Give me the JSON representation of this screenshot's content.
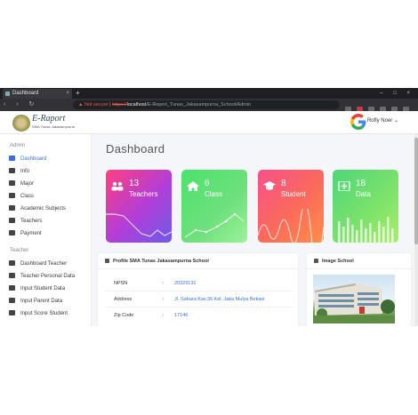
{
  "browser": {
    "tab_title": "Dashboard",
    "tab_close": "×",
    "new_tab": "+",
    "window_controls": "– □ ×",
    "nav_buttons": "‹ › ↻",
    "url_warning": "▲ Not secure",
    "url_scheme": "https://",
    "url_host": "localhost",
    "url_path": "/E-Report_Tunas_Jakasampurna_School/Admin"
  },
  "header": {
    "brand": "E-Raport",
    "brand_sub": "SMA Tunas Jakasampurna",
    "user_name": "Rofly Noer",
    "user_caret": "⌄"
  },
  "sidebar": {
    "admin_section": "Admin",
    "admin_items": [
      {
        "label": "Dashboard",
        "icon": "dashboard-icon",
        "active": true
      },
      {
        "label": "Info",
        "icon": "user-icon"
      },
      {
        "label": "Major",
        "icon": "users-icon"
      },
      {
        "label": "Class",
        "icon": "class-icon"
      },
      {
        "label": "Academic Subjects",
        "icon": "book-icon"
      },
      {
        "label": "Teachers",
        "icon": "teacher-icon"
      },
      {
        "label": "Payment",
        "icon": "payment-icon"
      }
    ],
    "teacher_section": "Teacher",
    "teacher_items": [
      {
        "label": "Dashboard Teacher",
        "icon": "dashboard-icon"
      },
      {
        "label": "Teacher Personal Data",
        "icon": "id-card-icon"
      },
      {
        "label": "Input Student Data",
        "icon": "edit-icon"
      },
      {
        "label": "Input Parent Data",
        "icon": "edit-icon"
      },
      {
        "label": "Input Score Student",
        "icon": "edit-icon"
      }
    ]
  },
  "main": {
    "title": "Dashboard",
    "cards": [
      {
        "count": "13",
        "label": "Teachers",
        "icon": "users-icon"
      },
      {
        "count": "6",
        "label": "Class",
        "icon": "home-icon"
      },
      {
        "count": "8",
        "label": "Student",
        "icon": "graduation-cap-icon"
      },
      {
        "count": "18",
        "label": "Data",
        "icon": "plus-square-icon"
      }
    ],
    "profile": {
      "header": "Profile SMA Tunas Jakasampurna School",
      "rows": [
        {
          "key": "NPSN",
          "sep": ":",
          "value": "20229131"
        },
        {
          "key": "Address",
          "sep": ":",
          "value": "Jl. Sahara Kav.36 Kel. Jaka Mulya Bekasi"
        },
        {
          "key": "Zip Code",
          "sep": ":",
          "value": "17146"
        }
      ]
    },
    "image_panel": {
      "header": "Image School"
    }
  },
  "colors": {
    "accent": "#3b6fd8",
    "card_teachers": "#b03ed9",
    "card_class": "#4be36b",
    "card_student": "#fb6b5a",
    "card_data": "#7ee36a"
  }
}
